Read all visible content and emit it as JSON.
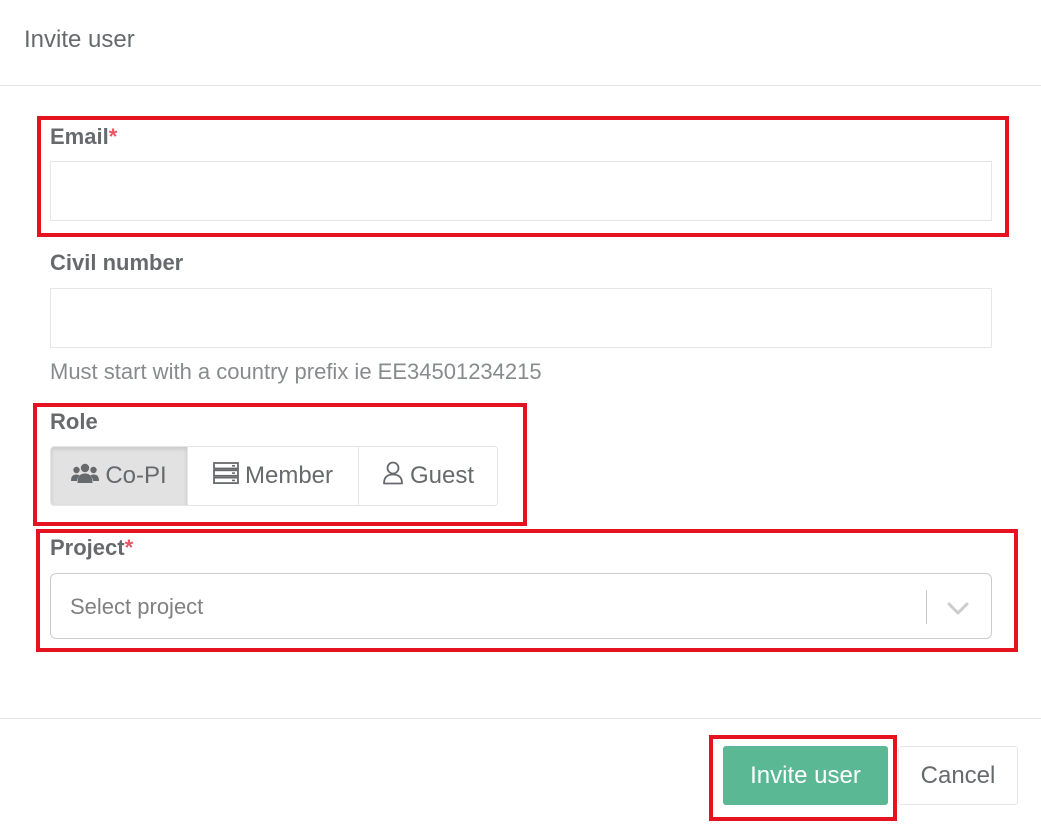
{
  "dialog": {
    "title": "Invite user"
  },
  "email": {
    "label": "Email",
    "required_mark": "*",
    "value": ""
  },
  "civil_number": {
    "label": "Civil number",
    "value": "",
    "help": "Must start with a country prefix ie EE34501234215"
  },
  "role": {
    "label": "Role",
    "selected": "Co-PI",
    "options": [
      {
        "label": "Co-PI",
        "icon": "users-icon"
      },
      {
        "label": "Member",
        "icon": "server-icon"
      },
      {
        "label": "Guest",
        "icon": "user-outline-icon"
      }
    ]
  },
  "project": {
    "label": "Project",
    "required_mark": "*",
    "placeholder": "Select project"
  },
  "footer": {
    "submit_label": "Invite user",
    "cancel_label": "Cancel"
  },
  "colors": {
    "primary": "#5bb894",
    "required": "#ed5565",
    "annotation": "#e5121f"
  }
}
